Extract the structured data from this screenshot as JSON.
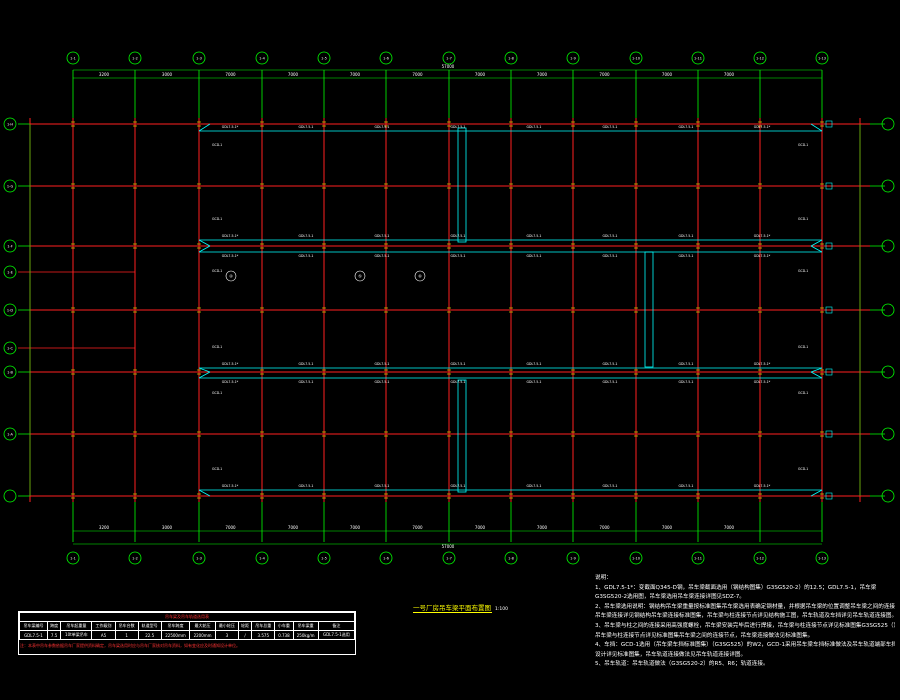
{
  "drawing": {
    "title": "一号厂房吊车梁平面布置图",
    "scale": "1:100",
    "total_dim": "57000"
  },
  "columns": [
    "1-1",
    "1-2",
    "1-3",
    "1-4",
    "1-5",
    "1-6",
    "1-7",
    "1-8",
    "1-9",
    "1-10",
    "1-11",
    "1-12",
    "1-13"
  ],
  "rows": [
    "1-H",
    "1-G",
    "1-F",
    "1-E",
    "1-D",
    "1-C",
    "1-B",
    "1-A"
  ],
  "top_spans": [
    "3200",
    "3000",
    "7000",
    "7000",
    "7000",
    "7000",
    "7000",
    "7000",
    "7000",
    "7000",
    "7000"
  ],
  "bottom_spans": [
    "3200",
    "3000",
    "7000",
    "7000",
    "7000",
    "7000",
    "7000",
    "7000",
    "7000",
    "7000",
    "7000"
  ],
  "left_dims": [
    "3000",
    "7000",
    "2500",
    "3000",
    "3000",
    "7000",
    "7000"
  ],
  "crane_beam_labels": [
    "GDL7.5-1*",
    "GDL7.5-1",
    "GDL7.5-1",
    "GDL7.5-1",
    "GDL7.5-1",
    "GDL7.5-1",
    "GDL7.5-1",
    "GDL7.5-1*"
  ],
  "brace_label": "GCD-1",
  "callout_labels": [
    "④",
    "⑤",
    "⑥"
  ],
  "notes": [
    "说明：",
    "1、GDL7.5-1*：变截面Q345-D钢，吊车梁截面选用（钢结构图集）G3SG520-2）的12.5；GDL7.5-1，吊车梁",
    "G3SG520-2选用图，吊车梁选用吊车梁连接详图见SDZ-7。",
    "2、吊车梁选用说明：钢结构吊车梁重量按标准图集吊车梁选用表确定钢材量，并根据吊车梁的位置调整吊车梁之间的连接，",
    "吊车梁连接详见钢结构吊车梁连接标准图集，吊车梁与柱连接节点详见结构施工图，吊车轨道及车挡详见吊车轨道连接图。",
    "3、吊车梁与柱之间的连接采用高强度螺栓，吊车梁安装完毕后进行焊接，吊车梁与柱连接节点详见标准图集G3SG525（）。",
    "吊车梁与柱连接节点详见标准图集吊车梁之间的连接节点，吊车梁连接做法见标准图集。",
    "4、车挡：GCD-1选用（吊车梁车挡标准图集）（G3SG525）的W2，GCD-1采用吊车梁车挡标准做法及吊车轨道端部车挡",
    "设计详见标准图集，吊车轨道连接做法见吊车轨道连接详图。",
    "5、吊车轨道：吊车轨道做法（G3SG520-2）的R5、R6；轨道连接。"
  ],
  "legend": {
    "caption": "吊车梁及吊车轨道选用表",
    "headers": [
      "吊车梁编号",
      "跨度",
      "吊车起重量",
      "工作级别",
      "吊车台数",
      "轨道型号",
      "吊车跨度",
      "最大轮压",
      "最小轮压",
      "轮距",
      "吊车总重",
      "小车重",
      "吊车梁重",
      "备注"
    ],
    "row": [
      "GDL7.5-1",
      "7.5",
      "10t单梁吊车",
      "A5",
      "1",
      "22.5",
      "22500mm",
      "2200mm",
      "3",
      "/",
      "3.575",
      "0.738",
      "250kg/m",
      "GDL7.5-1选用"
    ],
    "footnote": "注：本表中吊车参数依据吊车厂家提供资料确定，吊车梁选用时应与吊车厂家核对吊车资料，如有变化应及时通知设计单位。"
  },
  "colors": {
    "grid": "#00ff00",
    "beam": "#ff2020",
    "rail": "#00ffff",
    "text": "#ffffff",
    "title": "#ffff00",
    "background": "#000000"
  }
}
